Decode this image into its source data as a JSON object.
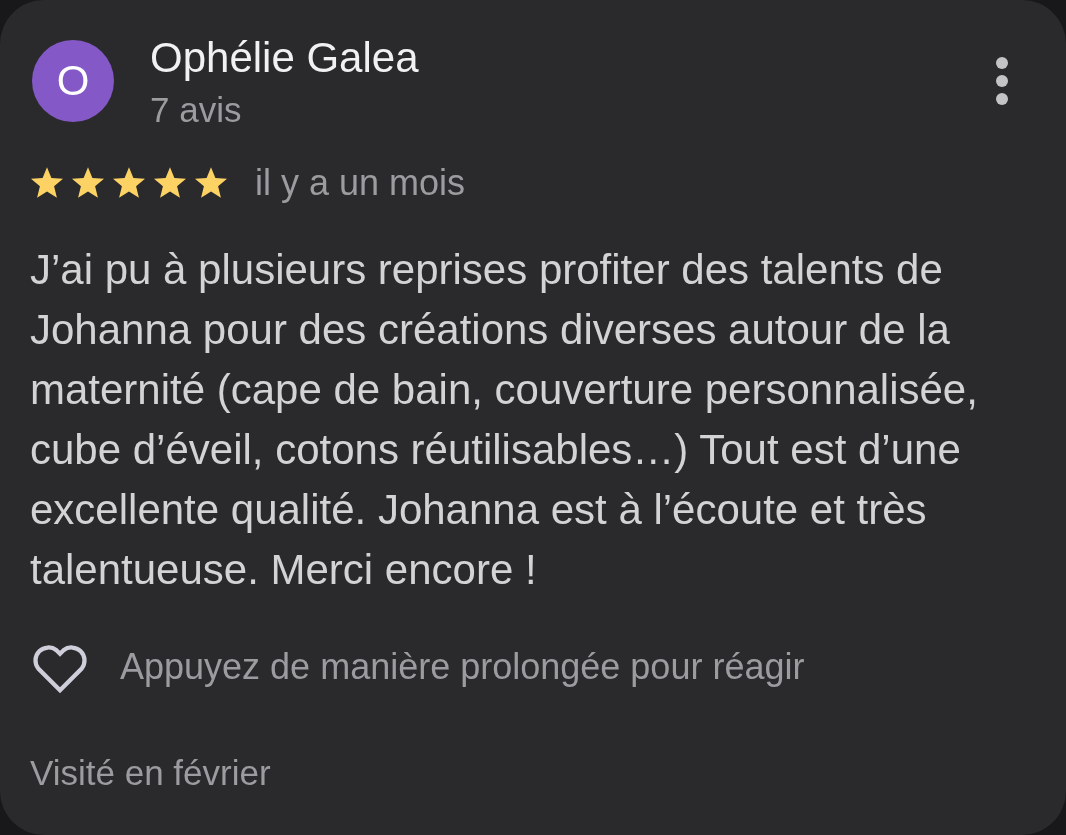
{
  "review": {
    "avatar_letter": "O",
    "author": "Ophélie Galea",
    "review_count": "7 avis",
    "stars": 5,
    "time": "il y a un mois",
    "text": "J’ai pu à plusieurs reprises profiter des talents de Johanna pour des créations diverses autour de la maternité (cape de bain, couverture personnalisée, cube d’éveil, cotons réutilisables…) Tout est d’une excellente qualité. Johanna est à l’écoute et très talentueuse. Merci encore !",
    "reaction_hint": "Appuyez de manière prolongée pour réagir",
    "visit": "Visité en février"
  }
}
